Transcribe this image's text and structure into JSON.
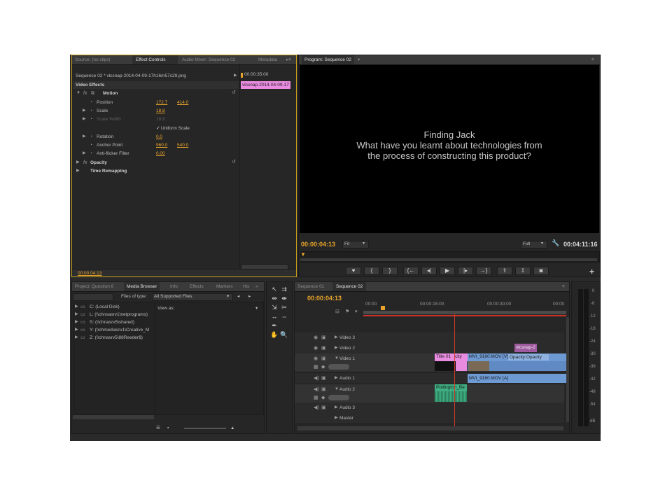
{
  "source_panel": {
    "tabs": [
      "Source: (no clips)",
      "Effect Controls",
      "Audio Mixer: Sequence 02",
      "Metadata"
    ],
    "sequence_label": "Sequence 02 * vlcsnap-2014-04-09-17h16m57s29.png",
    "timecode_top": "00:00:35:00",
    "clip_name": "vlcsnap-2014-04-09-17",
    "section": "Video Effects",
    "motion": "Motion",
    "position_label": "Position",
    "position_x": "172.7",
    "position_y": "414.0",
    "scale_label": "Scale",
    "scale_value": "18.8",
    "scale_width_label": "Scale Width",
    "scale_width_value": "18.8",
    "uniform_scale": "Uniform Scale",
    "rotation_label": "Rotation",
    "rotation_value": "0.0",
    "anchor_label": "Anchor Point",
    "anchor_x": "960.0",
    "anchor_y": "540.0",
    "antiflicker_label": "Anti-flicker Filter",
    "antiflicker_value": "0.00",
    "opacity": "Opacity",
    "time_remap": "Time Remapping",
    "timecode_bottom": "00:00:04:13"
  },
  "program_monitor": {
    "tab": "Program: Sequence 02",
    "line1": "Finding Jack",
    "line2": "What have you learnt about technologies from",
    "line3": "the process of constructing this product?",
    "timecode_current": "00:00:04:13",
    "fit": "Fit",
    "quality": "Full",
    "timecode_duration": "00:04:11:16",
    "add_button": "+"
  },
  "project_panel": {
    "tabs": [
      "Project: Question 6",
      "Media Browser",
      "Info",
      "Effects",
      "Markers",
      "His"
    ],
    "files_of_type_label": "Files of type:",
    "files_of_type_value": "All Supported Files",
    "view_as": "View as:",
    "drives": [
      "C: (Local Disk)",
      "L: (\\\\chnsasrv1\\netprograms)",
      "S: (\\\\chnasrv5\\shared)",
      "Y: (\\\\chmediasrv1\\Creative_M",
      "Z: (\\\\chnasrv5\\88Reeder$)"
    ]
  },
  "timeline": {
    "tabs": [
      "Sequence 01",
      "Sequence 02"
    ],
    "timecode": "00:00:04:13",
    "ruler": [
      "00:00",
      "00:00:15:00",
      "00:00:30:00",
      "00:00"
    ],
    "tracks": [
      "Video 3",
      "Video 2",
      "Video 1",
      "Audio 1",
      "Audio 2",
      "Audio 3",
      "Master"
    ],
    "clips": {
      "vlcsnap": "vlcsnap-2",
      "title": "Title 01",
      "city": "city",
      "mvi_video": "MVI_9160.MOV [V]",
      "opacity": "Opacity:Opacity",
      "mvi_audio": "MVI_9160.MOV [A]",
      "podington": "Podington_Be"
    }
  },
  "audio_meter": {
    "labels": [
      "0",
      "-6",
      "-12",
      "-18",
      "-24",
      "-30",
      "-36",
      "-42",
      "-48",
      "-54",
      "dB"
    ]
  },
  "colors": {
    "accent": "#e8a42a",
    "video_clip": "#6e9ad3",
    "title_clip": "#e98ce0",
    "vlcsnap_clip": "#a05aa0",
    "audio_clip": "#3fae82",
    "playhead": "#d23a2a"
  }
}
